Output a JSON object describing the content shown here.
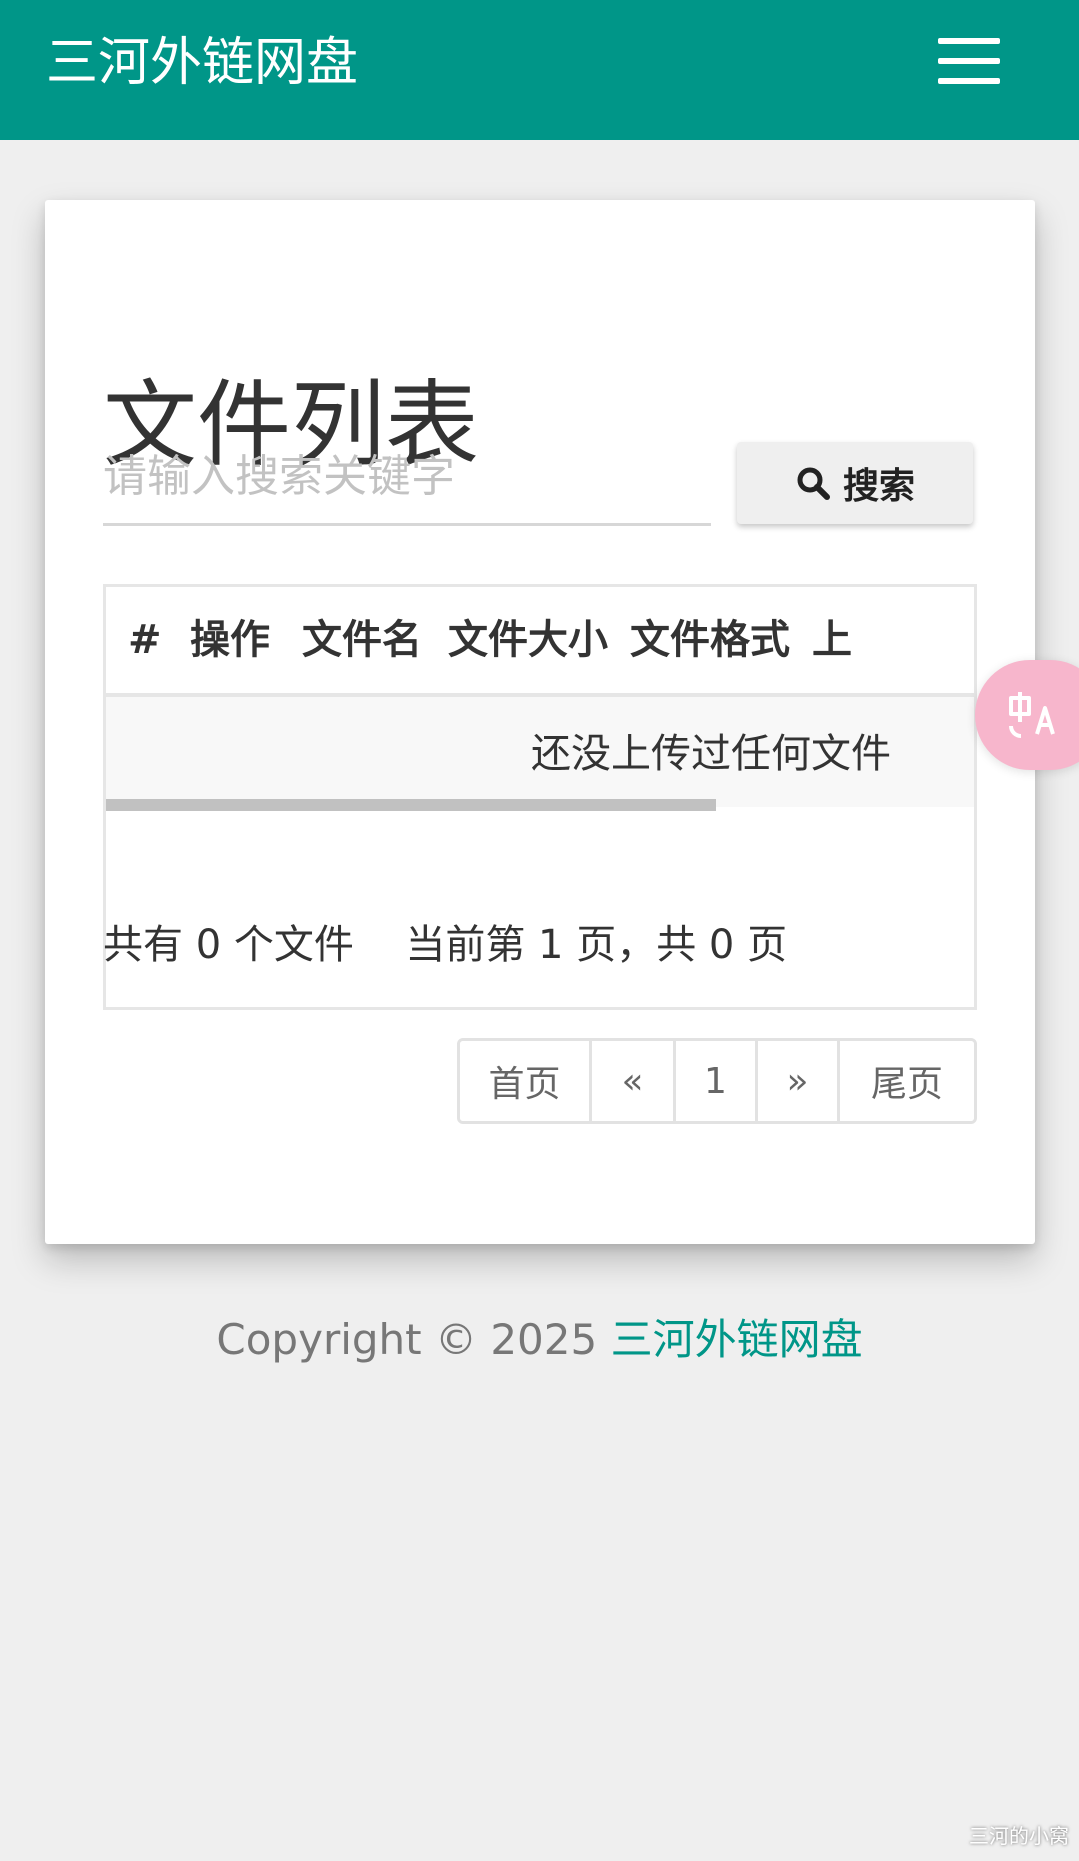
{
  "navbar": {
    "brand": "三河外链网盘",
    "menu_icon": "hamburger-icon"
  },
  "main": {
    "title": "文件列表",
    "search": {
      "placeholder": "请输入搜索关键字",
      "value": "",
      "button_label": "搜索",
      "button_icon": "search-icon"
    },
    "table": {
      "columns": [
        "#",
        "操作",
        "文件名",
        "文件大小",
        "文件格式",
        "上"
      ],
      "empty_message": "还没上传过任何文件"
    },
    "summary": {
      "total": "共有 0 个文件",
      "page_info": "当前第 1 页，共 0 页"
    },
    "pagination": {
      "first": "首页",
      "prev": "«",
      "current": "1",
      "next": "»",
      "last": "尾页"
    }
  },
  "footer": {
    "copyright": "Copyright © 2025",
    "site_link": "三河外链网盘"
  },
  "overlay": {
    "translate_icon": "translate-icon",
    "watermark": "三河的小窝"
  },
  "colors": {
    "primary": "#009688",
    "background": "#efefef",
    "fab": "#f7b6cc"
  }
}
